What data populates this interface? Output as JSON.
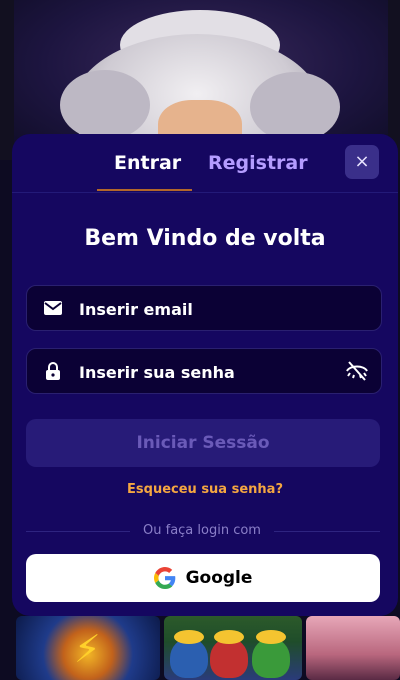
{
  "tabs": {
    "login": "Entrar",
    "register": "Registrar"
  },
  "close_icon": "×",
  "welcome": "Bem Vindo de volta",
  "email": {
    "placeholder": "Inserir email",
    "value": ""
  },
  "password": {
    "placeholder": "Inserir sua senha",
    "value": ""
  },
  "submit_label": "Iniciar Sessão",
  "forgot_label": "Esqueceu sua senha?",
  "divider_label": "Ou faça login com",
  "google_label": "Google",
  "colors": {
    "modal_bg": "#150760",
    "input_bg": "#0b0135",
    "submit_bg": "#271b78",
    "accent_orange": "#f4a641",
    "register_tab": "#b49cff"
  },
  "icons": [
    "mail-icon",
    "lock-icon",
    "eye-off-icon",
    "close-icon",
    "google-icon"
  ]
}
